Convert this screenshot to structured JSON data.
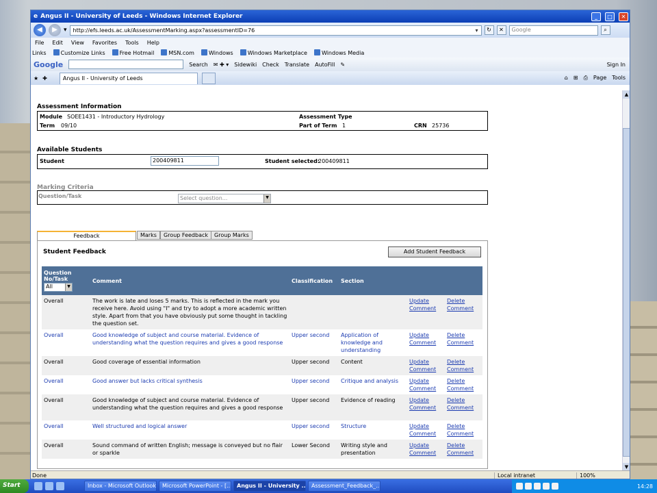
{
  "window": {
    "title": "Angus II - University of Leeds - Windows Internet Explorer"
  },
  "address": {
    "url": "http://efs.leeds.ac.uk/AssessmentMarking.aspx?assessmentID=76",
    "search_placeholder": "Google"
  },
  "menu": [
    "File",
    "Edit",
    "View",
    "Favorites",
    "Tools",
    "Help"
  ],
  "links": {
    "label": "Links",
    "items": [
      "Customize Links",
      "Free Hotmail",
      "MSN.com",
      "Windows",
      "Windows Marketplace",
      "Windows Media"
    ]
  },
  "googlebar": {
    "logo": "Google",
    "items": [
      "Search",
      "Sidewiki",
      "Check",
      "Translate",
      "AutoFill"
    ],
    "signin": "Sign In"
  },
  "tab": {
    "title": "Angus II - University of Leeds",
    "tools": [
      "Page",
      "Tools"
    ]
  },
  "assessment": {
    "section_title": "Assessment Information",
    "module_label": "Module",
    "module_value": "SOEE1431 - Introductory Hydrology",
    "type_label": "Assessment Type",
    "term_label": "Term",
    "term_value": "09/10",
    "part_label": "Part of Term",
    "part_value": "1",
    "crn_label": "CRN",
    "crn_value": "25736"
  },
  "students": {
    "section_title": "Available Students",
    "student_label": "Student",
    "student_input": "200409811",
    "selected_label": "Student selected:",
    "selected_value": "200409811"
  },
  "marking": {
    "section_title": "Marking Criteria",
    "question_label": "Question/Task",
    "select_placeholder": "Select question..."
  },
  "tabs": [
    "Feedback",
    "Marks",
    "Group Feedback",
    "Group Marks"
  ],
  "feedback": {
    "title": "Student Feedback",
    "add_button": "Add Student Feedback",
    "headers": {
      "question": "Question No/Task",
      "comment": "Comment",
      "classification": "Classification",
      "section": "Section"
    },
    "filter_value": "All",
    "rows": [
      {
        "q": "Overall",
        "comment": "The work is late and loses 5 marks. This is reflected in the mark you receive here. Avoid using \"I\" and try to adopt a more academic written style. Apart from that you have obviously put some thought in tackling the question set.",
        "classification": "",
        "section": "",
        "update": "Update Comment",
        "delete": "Delete Comment"
      },
      {
        "q": "Overall",
        "comment": "Good knowledge of subject and course material. Evidence of understanding what the question requires and gives a good response",
        "classification": "Upper second",
        "section": "Application of knowledge and understanding",
        "update": "Update Comment",
        "delete": "Delete Comment"
      },
      {
        "q": "Overall",
        "comment": "Good coverage of essential information",
        "classification": "Upper second",
        "section": "Content",
        "update": "Update Comment",
        "delete": "Delete Comment"
      },
      {
        "q": "Overall",
        "comment": "Good answer but lacks critical synthesis",
        "classification": "Upper second",
        "section": "Critique and analysis",
        "update": "Update Comment",
        "delete": "Delete Comment"
      },
      {
        "q": "Overall",
        "comment": "Good knowledge of subject and course material. Evidence of understanding what the question requires and gives a good response",
        "classification": "Upper second",
        "section": "Evidence of reading",
        "update": "Update Comment",
        "delete": "Delete Comment"
      },
      {
        "q": "Overall",
        "comment": "Well structured and logical answer",
        "classification": "Upper second",
        "section": "Structure",
        "update": "Update Comment",
        "delete": "Delete Comment"
      },
      {
        "q": "Overall",
        "comment": "Sound command of written English; message is conveyed but no flair or sparkle",
        "classification": "Lower Second",
        "section": "Writing style and presentation",
        "update": "Update Comment",
        "delete": "Delete Comment"
      }
    ]
  },
  "status": {
    "text": "Done",
    "zone": "Local intranet",
    "zoom": "100%"
  },
  "taskbar": {
    "start": "Start",
    "items": [
      "Inbox - Microsoft Outlook",
      "Microsoft PowerPoint - [...",
      "Angus II - University ...",
      "Assessment_Feedback_..."
    ],
    "clock": "14:28"
  },
  "colors": {
    "header_bg": "#4f7097",
    "link": "#1a3ab0",
    "tab_accent": "#f5b335"
  }
}
